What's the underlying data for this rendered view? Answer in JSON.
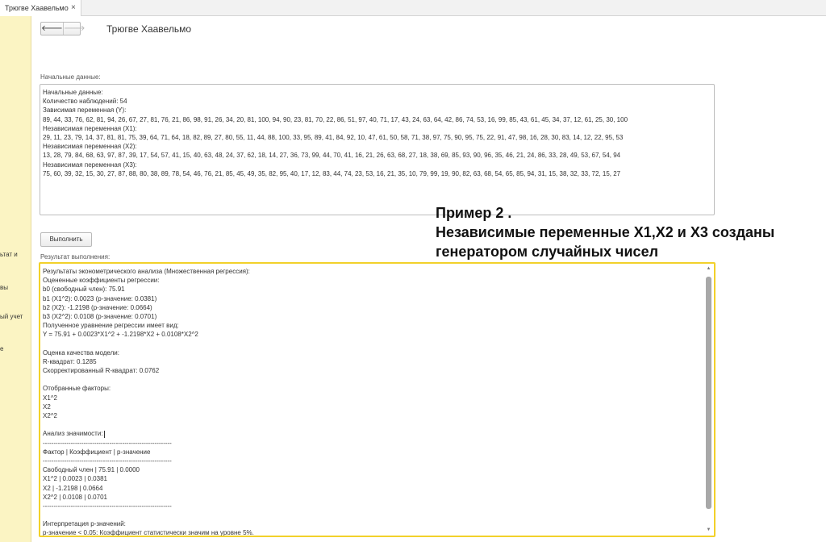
{
  "tab": {
    "title": "Трюгве Хаавельмо",
    "close": "×"
  },
  "sidebar": {
    "items": [
      "ьтат и",
      "вы",
      "ый учет",
      "е"
    ]
  },
  "nav": {
    "back": "🡐",
    "forward": "🡒"
  },
  "page": {
    "title": "Трюгве Хаавельмо"
  },
  "input_section": {
    "label": "Начальные данные:",
    "lines": [
      "Начальные данные:",
      "Количество наблюдений: 54",
      "Зависимая переменная (Y):",
      "89, 44, 33, 76, 62, 81, 94, 26, 67, 27, 81, 76, 21, 86, 98, 91, 26, 34, 20, 81, 100, 94, 90, 23, 81, 70, 22, 86, 51, 97, 40, 71, 17, 43, 24, 63, 64, 42, 86, 74, 53, 16, 99, 85, 43, 61, 45, 34, 37, 12, 61, 25, 30, 100",
      "Независимая переменная (X1):",
      "29, 11, 23, 79, 14, 37, 81, 81, 75, 39, 64, 71, 64, 18, 82, 89, 27, 80, 55, 11, 44, 88, 100, 33, 95, 89, 41, 84, 92, 10, 47, 61, 50, 58, 71, 38, 97, 75, 90, 95, 75, 22, 91, 47, 98, 16, 28, 30, 83, 14, 12, 22, 95, 53",
      "Независимая переменная (X2):",
      "13, 28, 79, 84, 68, 63, 97, 87, 39, 17, 54, 57, 41, 15, 40, 63, 48, 24, 37, 62, 18, 14, 27, 36, 73, 99, 44, 70, 41, 16, 21, 26, 63, 68, 27, 18, 38, 69, 85, 93, 90, 96, 35, 46, 21, 24, 86, 33, 28, 49, 53, 67, 54, 94",
      "Независимая переменная (X3):",
      "75, 60, 39, 32, 15, 30, 27, 87, 88, 80, 38, 89, 78, 54, 46, 76, 21, 85, 45, 49, 35, 82, 95, 40, 17, 12, 83, 44, 74, 23, 53, 16, 21, 35, 10, 79, 99, 19, 90, 82, 63, 68, 54, 65, 85, 94, 31, 15, 38, 32, 33, 72, 15, 27"
    ]
  },
  "run_button": {
    "label": "Выполнить"
  },
  "overlay": {
    "lines": [
      "Пример 2 .",
      "Независимые переменные X1,X2 и X3  созданы",
      "генератором случайных чисел"
    ]
  },
  "result_section": {
    "label": "Результат выполнения:",
    "lines": [
      "Результаты эконометрического анализа (Множественная регрессия):",
      "Оцененные коэффициенты регрессии:",
      "b0 (свободный член): 75.91",
      "b1 (X1^2): 0.0023 (p-значение: 0.0381)",
      "b2 (X2): -1.2198 (p-значение: 0.0664)",
      "b3 (X2^2): 0.0108 (p-значение: 0.0701)",
      "Полученное уравнение регрессии имеет вид:",
      "Y = 75.91 + 0.0023*X1^2 + -1.2198*X2 + 0.0108*X2^2",
      "",
      "Оценка качества модели:",
      "R-квадрат: 0.1285",
      "Скорректированный R-квадрат: 0.0762",
      "",
      "Отобранные факторы:",
      "X1^2",
      "X2",
      "X2^2",
      "",
      "Анализ значимости:",
      "------------------------------------------------------------",
      "Фактор          | Коэффициент | p-значение",
      "------------------------------------------------------------",
      "Свободный член | 75.91 | 0.0000",
      "X1^2 | 0.0023 | 0.0381",
      "X2 | -1.2198 | 0.0664",
      "X2^2 | 0.0108 | 0.0701",
      "------------------------------------------------------------",
      "",
      "Интерпретация p-значений:",
      "p-значение < 0.05: Коэффициент статистически значим на уровне 5%."
    ]
  },
  "scrollbar": {
    "up": "▲",
    "down": "▼"
  }
}
